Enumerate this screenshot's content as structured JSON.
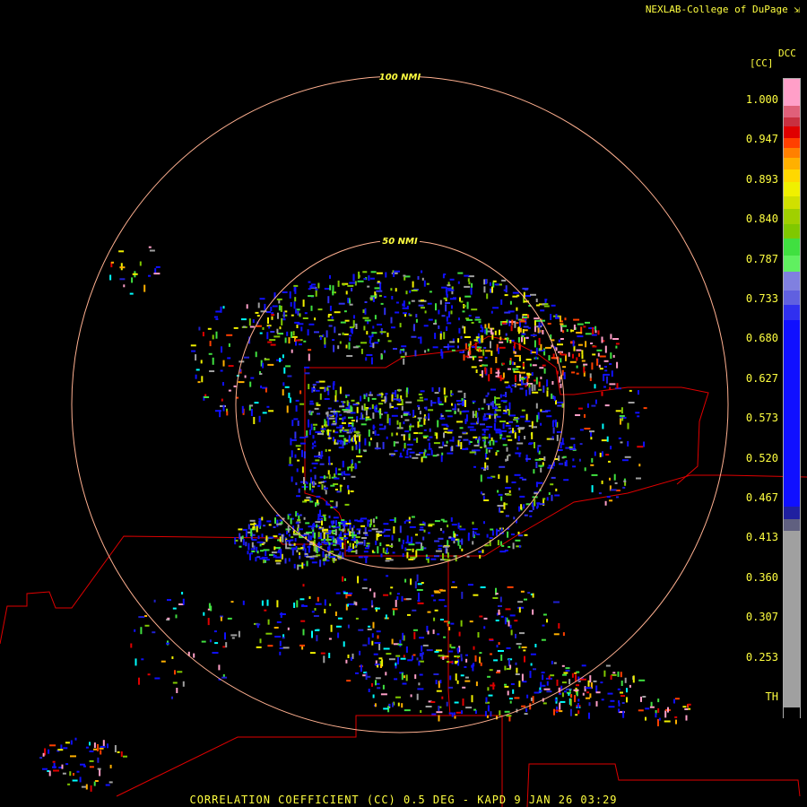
{
  "credit": "NEXLAB-College of DuPage ⇲",
  "caption": "CORRELATION COEFFICIENT (CC) 0.5 DEG - KAPD 9 JAN 26 03:29",
  "rings": [
    {
      "label": "100 NMI",
      "nmi": 100
    },
    {
      "label": "50 NMI",
      "nmi": 50
    }
  ],
  "legend": {
    "product": "DCC",
    "unit": "[CC]",
    "ticks": [
      "1.000",
      "0.947",
      "0.893",
      "0.840",
      "0.787",
      "0.733",
      "0.680",
      "0.627",
      "0.573",
      "0.520",
      "0.467",
      "0.413",
      "0.360",
      "0.307",
      "0.253",
      "TH"
    ],
    "bands": [
      {
        "color": "#ff9fc8",
        "frac": 0.042
      },
      {
        "color": "#e0607a",
        "frac": 0.018
      },
      {
        "color": "#c83040",
        "frac": 0.014
      },
      {
        "color": "#e00000",
        "frac": 0.018
      },
      {
        "color": "#ff4000",
        "frac": 0.016
      },
      {
        "color": "#ff8000",
        "frac": 0.016
      },
      {
        "color": "#ffb000",
        "frac": 0.018
      },
      {
        "color": "#ffd800",
        "frac": 0.02
      },
      {
        "color": "#f0f000",
        "frac": 0.022
      },
      {
        "color": "#d0e000",
        "frac": 0.02
      },
      {
        "color": "#a0d000",
        "frac": 0.024
      },
      {
        "color": "#80c800",
        "frac": 0.022
      },
      {
        "color": "#40e040",
        "frac": 0.026
      },
      {
        "color": "#60f060",
        "frac": 0.026
      },
      {
        "color": "#8080e0",
        "frac": 0.03
      },
      {
        "color": "#6060e0",
        "frac": 0.022
      },
      {
        "color": "#3030f0",
        "frac": 0.024
      },
      {
        "color": "#1010ff",
        "frac": 0.292
      },
      {
        "color": "#2020a0",
        "frac": 0.02
      },
      {
        "color": "#606080",
        "frac": 0.018
      },
      {
        "color": "#a0a0a0",
        "frac": 0.276
      },
      {
        "color": "#000000",
        "frac": 0.016
      }
    ]
  },
  "colors": {
    "ring": "#ffb090",
    "border": "#e00000",
    "text": "#ffff40"
  }
}
